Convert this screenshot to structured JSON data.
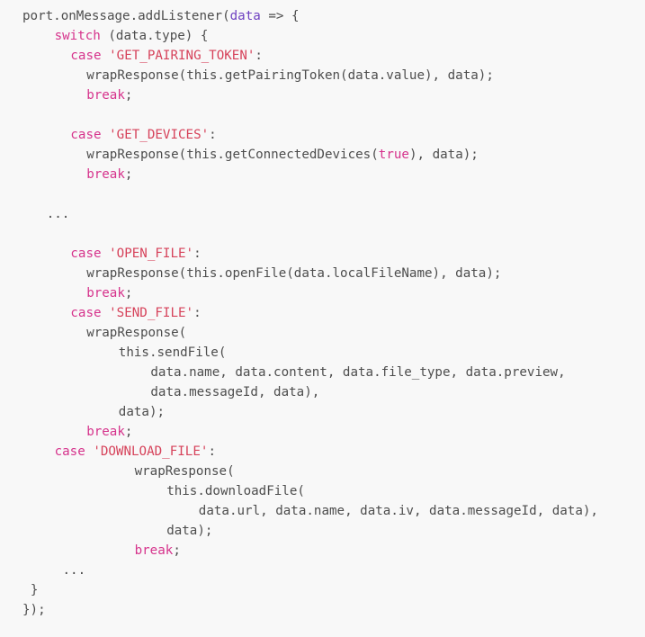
{
  "editor": {
    "language": "javascript",
    "background_color": "#f8f8f8",
    "colors": {
      "plain": "#4d4d4d",
      "keyword": "#d6338c",
      "string": "#d6425a",
      "parameter": "#6f42c1",
      "boolean": "#d6338c"
    }
  },
  "code": {
    "lines": [
      {
        "id": "l1",
        "indent": 0,
        "tokens": [
          {
            "t": "plain",
            "v": "port.onMessage.addListener("
          },
          {
            "t": "param",
            "v": "data"
          },
          {
            "t": "plain",
            "v": " => {"
          }
        ]
      },
      {
        "id": "l2",
        "indent": 4,
        "tokens": [
          {
            "t": "keyword",
            "v": "switch"
          },
          {
            "t": "plain",
            "v": " (data.type) {"
          }
        ]
      },
      {
        "id": "l3",
        "indent": 6,
        "tokens": [
          {
            "t": "keyword",
            "v": "case"
          },
          {
            "t": "plain",
            "v": " "
          },
          {
            "t": "string",
            "v": "'GET_PAIRING_TOKEN'"
          },
          {
            "t": "plain",
            "v": ":"
          }
        ]
      },
      {
        "id": "l4",
        "indent": 8,
        "tokens": [
          {
            "t": "plain",
            "v": "wrapResponse(this.getPairingToken(data.value), data);"
          }
        ]
      },
      {
        "id": "l5",
        "indent": 8,
        "tokens": [
          {
            "t": "keyword",
            "v": "break"
          },
          {
            "t": "plain",
            "v": ";"
          }
        ]
      },
      {
        "id": "l6",
        "indent": 0,
        "blank": true,
        "tokens": []
      },
      {
        "id": "l7",
        "indent": 6,
        "tokens": [
          {
            "t": "keyword",
            "v": "case"
          },
          {
            "t": "plain",
            "v": " "
          },
          {
            "t": "string",
            "v": "'GET_DEVICES'"
          },
          {
            "t": "plain",
            "v": ":"
          }
        ]
      },
      {
        "id": "l8",
        "indent": 8,
        "tokens": [
          {
            "t": "plain",
            "v": "wrapResponse(this.getConnectedDevices("
          },
          {
            "t": "boolean",
            "v": "true"
          },
          {
            "t": "plain",
            "v": "), data);"
          }
        ]
      },
      {
        "id": "l9",
        "indent": 8,
        "tokens": [
          {
            "t": "keyword",
            "v": "break"
          },
          {
            "t": "plain",
            "v": ";"
          }
        ]
      },
      {
        "id": "l10",
        "indent": 0,
        "blank": true,
        "tokens": []
      },
      {
        "id": "l11",
        "indent": 3,
        "tokens": [
          {
            "t": "ellipsis",
            "v": "..."
          }
        ]
      },
      {
        "id": "l12",
        "indent": 0,
        "blank": true,
        "tokens": []
      },
      {
        "id": "l13",
        "indent": 6,
        "tokens": [
          {
            "t": "keyword",
            "v": "case"
          },
          {
            "t": "plain",
            "v": " "
          },
          {
            "t": "string",
            "v": "'OPEN_FILE'"
          },
          {
            "t": "plain",
            "v": ":"
          }
        ]
      },
      {
        "id": "l14",
        "indent": 8,
        "tokens": [
          {
            "t": "plain",
            "v": "wrapResponse(this.openFile(data.localFileName), data);"
          }
        ]
      },
      {
        "id": "l15",
        "indent": 8,
        "tokens": [
          {
            "t": "keyword",
            "v": "break"
          },
          {
            "t": "plain",
            "v": ";"
          }
        ]
      },
      {
        "id": "l16",
        "indent": 6,
        "tokens": [
          {
            "t": "keyword",
            "v": "case"
          },
          {
            "t": "plain",
            "v": " "
          },
          {
            "t": "string",
            "v": "'SEND_FILE'"
          },
          {
            "t": "plain",
            "v": ":"
          }
        ]
      },
      {
        "id": "l17",
        "indent": 8,
        "tokens": [
          {
            "t": "plain",
            "v": "wrapResponse("
          }
        ]
      },
      {
        "id": "l18",
        "indent": 12,
        "tokens": [
          {
            "t": "plain",
            "v": "this.sendFile("
          }
        ]
      },
      {
        "id": "l19",
        "indent": 16,
        "tokens": [
          {
            "t": "plain",
            "v": "data.name, data.content, data.file_type, data.preview,"
          }
        ]
      },
      {
        "id": "l20",
        "indent": 16,
        "tokens": [
          {
            "t": "plain",
            "v": "data.messageId, data),"
          }
        ]
      },
      {
        "id": "l21",
        "indent": 12,
        "tokens": [
          {
            "t": "plain",
            "v": "data);"
          }
        ]
      },
      {
        "id": "l22",
        "indent": 8,
        "tokens": [
          {
            "t": "keyword",
            "v": "break"
          },
          {
            "t": "plain",
            "v": ";"
          }
        ]
      },
      {
        "id": "l23",
        "indent": 4,
        "tokens": [
          {
            "t": "keyword",
            "v": "case"
          },
          {
            "t": "plain",
            "v": " "
          },
          {
            "t": "string",
            "v": "'DOWNLOAD_FILE'"
          },
          {
            "t": "plain",
            "v": ":"
          }
        ]
      },
      {
        "id": "l24",
        "indent": 14,
        "tokens": [
          {
            "t": "plain",
            "v": "wrapResponse("
          }
        ]
      },
      {
        "id": "l25",
        "indent": 18,
        "tokens": [
          {
            "t": "plain",
            "v": "this.downloadFile("
          }
        ]
      },
      {
        "id": "l26",
        "indent": 22,
        "tokens": [
          {
            "t": "plain",
            "v": "data.url, data.name, data.iv, data.messageId, data),"
          }
        ]
      },
      {
        "id": "l27",
        "indent": 18,
        "tokens": [
          {
            "t": "plain",
            "v": "data);"
          }
        ]
      },
      {
        "id": "l28",
        "indent": 14,
        "tokens": [
          {
            "t": "keyword",
            "v": "break"
          },
          {
            "t": "plain",
            "v": ";"
          }
        ]
      },
      {
        "id": "l29",
        "indent": 5,
        "tokens": [
          {
            "t": "ellipsis",
            "v": "..."
          }
        ]
      },
      {
        "id": "l30",
        "indent": 1,
        "tokens": [
          {
            "t": "plain",
            "v": "}"
          }
        ]
      },
      {
        "id": "l31",
        "indent": 0,
        "tokens": [
          {
            "t": "plain",
            "v": "});"
          }
        ]
      }
    ]
  }
}
